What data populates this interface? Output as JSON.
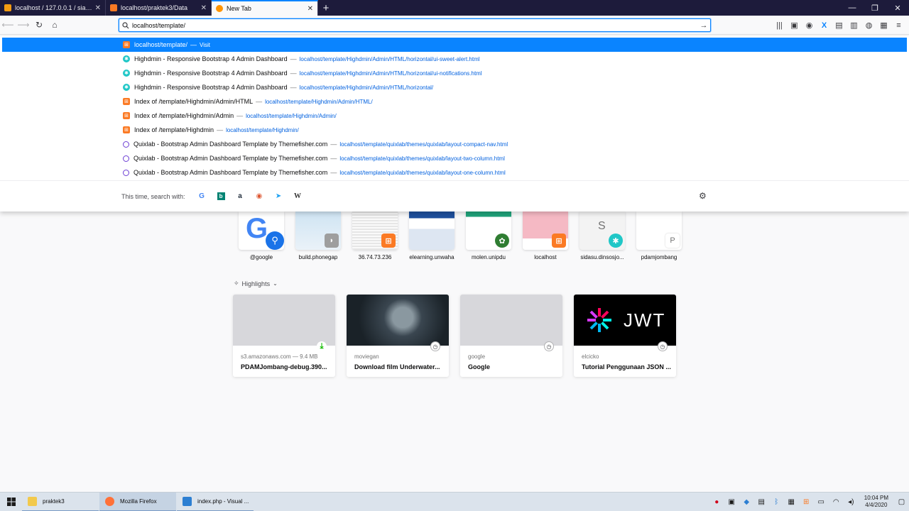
{
  "tabs": [
    {
      "title": "localhost / 127.0.0.1 / siakad / ...",
      "favicon_color": "#f39c12",
      "active": false
    },
    {
      "title": "localhost/praktek3/Data",
      "favicon_color": "#fb7a24",
      "active": false
    },
    {
      "title": "New Tab",
      "favicon_color": "#ff9400",
      "active": true
    }
  ],
  "navbar": {
    "url_value": "localhost/template/"
  },
  "suggestions": [
    {
      "title": "localhost/template/",
      "url": "Visit",
      "icon": "xampp",
      "selected": true
    },
    {
      "title": "Highdmin - Responsive Bootstrap 4 Admin Dashboard",
      "url": "localhost/template/Highdmin/Admin/HTML/horizontal/ui-sweet-alert.html",
      "icon": "hm"
    },
    {
      "title": "Highdmin - Responsive Bootstrap 4 Admin Dashboard",
      "url": "localhost/template/Highdmin/Admin/HTML/horizontal/ui-notifications.html",
      "icon": "hm"
    },
    {
      "title": "Highdmin - Responsive Bootstrap 4 Admin Dashboard",
      "url": "localhost/template/Highdmin/Admin/HTML/horizontal/",
      "icon": "hm"
    },
    {
      "title": "Index of /template/Highdmin/Admin/HTML",
      "url": "localhost/template/Highdmin/Admin/HTML/",
      "icon": "xampp"
    },
    {
      "title": "Index of /template/Highdmin/Admin",
      "url": "localhost/template/Highdmin/Admin/",
      "icon": "xampp"
    },
    {
      "title": "Index of /template/Highdmin",
      "url": "localhost/template/Highdmin/",
      "icon": "xampp"
    },
    {
      "title": "Quixlab - Bootstrap Admin Dashboard Template by Themefisher.com",
      "url": "localhost/template/quixlab/themes/quixlab/layout-compact-nav.html",
      "icon": "q"
    },
    {
      "title": "Quixlab - Bootstrap Admin Dashboard Template by Themefisher.com",
      "url": "localhost/template/quixlab/themes/quixlab/layout-two-column.html",
      "icon": "q"
    },
    {
      "title": "Quixlab - Bootstrap Admin Dashboard Template by Themefisher.com",
      "url": "localhost/template/quixlab/themes/quixlab/layout-one-column.html",
      "icon": "q"
    }
  ],
  "search_with_label": "This time, search with:",
  "engines": [
    {
      "name": "google-icon",
      "glyph": "G",
      "color": "#4285f4"
    },
    {
      "name": "bing-icon",
      "glyph": "b",
      "color": "#008373"
    },
    {
      "name": "amazon-icon",
      "glyph": "a",
      "color": "#232f3e"
    },
    {
      "name": "duckduckgo-icon",
      "glyph": "◉",
      "color": "#de5833"
    },
    {
      "name": "twitter-icon",
      "glyph": "🐦",
      "color": "#1da1f2"
    },
    {
      "name": "wikipedia-icon",
      "glyph": "W",
      "color": "#333333"
    }
  ],
  "top_sites": [
    {
      "label": "@google"
    },
    {
      "label": "build.phonegap"
    },
    {
      "label": "36.74.73.236"
    },
    {
      "label": "elearning.unwaha"
    },
    {
      "label": "molen.unipdu"
    },
    {
      "label": "localhost"
    },
    {
      "label": "sidasu.dinsosjo..."
    },
    {
      "label": "pdamjombang"
    }
  ],
  "highlights_label": "Highlights",
  "highlights": [
    {
      "source": "s3.amazonaws.com — 9.4 MB",
      "title": "PDAMJombang-debug.390...",
      "icon": "download"
    },
    {
      "source": "moviegan",
      "title": "Download film Underwater...",
      "icon": "history"
    },
    {
      "source": "google",
      "title": "Google",
      "icon": "history"
    },
    {
      "source": "elcicko",
      "title": "Tutorial Penggunaan JSON ...",
      "icon": "history"
    }
  ],
  "taskbar": {
    "items": [
      {
        "label": "praktek3",
        "color": "#f2c94c"
      },
      {
        "label": "Mozilla Firefox",
        "color": "#ff7139"
      },
      {
        "label": "index.php - Visual ...",
        "color": "#2d7fd2"
      }
    ],
    "time": "10:04 PM",
    "date": "4/4/2020"
  }
}
